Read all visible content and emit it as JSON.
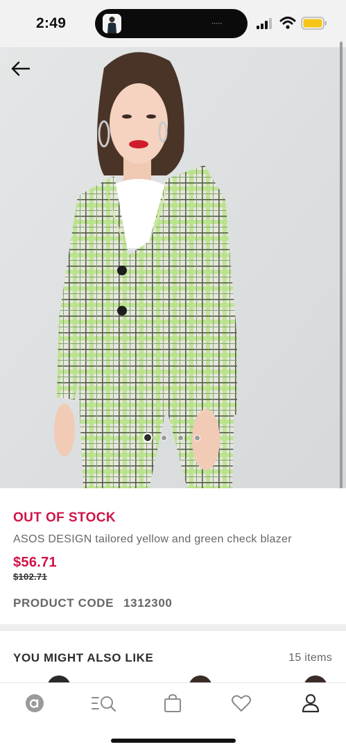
{
  "status_bar": {
    "time": "2:49",
    "island_dots": "•••••",
    "signal_icon": "signal-bars-icon",
    "wifi_icon": "wifi-icon",
    "battery_icon": "battery-icon",
    "battery_color": "#f5c518"
  },
  "hero": {
    "back_icon": "arrow-left-icon",
    "image_subject": "product-photo",
    "carousel": {
      "total": 4,
      "active": 1
    }
  },
  "product": {
    "stock_status": "OUT OF STOCK",
    "title": "ASOS DESIGN tailored yellow and green check blazer",
    "price": "$56.71",
    "was_price": "$102.71",
    "code_label": "PRODUCT CODE",
    "code_value": "1312300"
  },
  "recommendations": {
    "title": "YOU MIGHT ALSO LIKE",
    "count": "15 items"
  },
  "bottom_nav": {
    "items": [
      {
        "name": "home",
        "icon": "asos-logo-icon"
      },
      {
        "name": "search",
        "icon": "search-icon"
      },
      {
        "name": "bag",
        "icon": "bag-icon"
      },
      {
        "name": "saved",
        "icon": "heart-icon"
      },
      {
        "name": "account",
        "icon": "user-icon"
      }
    ]
  },
  "colors": {
    "accent": "#d01345",
    "text_primary": "#2d2d2d",
    "text_secondary": "#666666",
    "status_bar_bg": "#f2f2f2"
  }
}
